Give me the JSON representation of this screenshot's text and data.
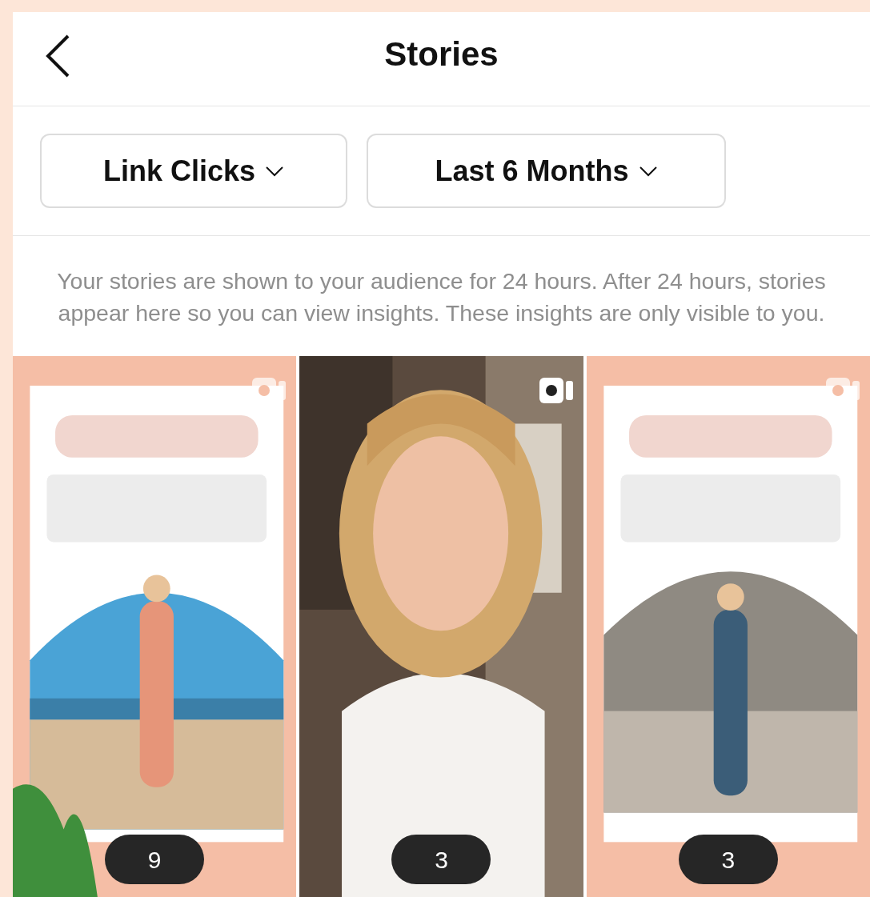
{
  "header": {
    "title": "Stories"
  },
  "filters": [
    {
      "label": "Link Clicks"
    },
    {
      "label": "Last 6 Months"
    }
  ],
  "description": "Your stories are shown to your audience for 24 hours. After 24 hours, stories appear here so you can view insights. These insights are only visible to you.",
  "stories": [
    {
      "kind": "picture",
      "count": "9"
    },
    {
      "kind": "picture",
      "count": "3"
    },
    {
      "kind": "picture",
      "count": "3"
    }
  ]
}
